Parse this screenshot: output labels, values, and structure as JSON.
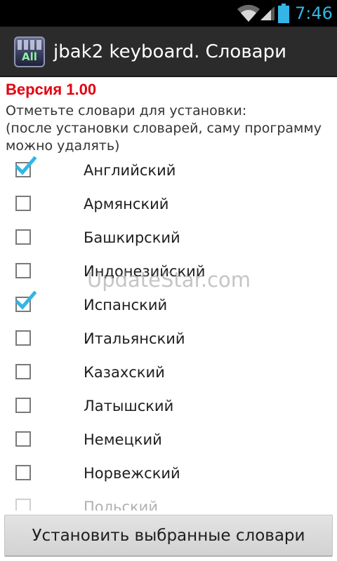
{
  "status_bar": {
    "time": "7:46",
    "icons": [
      "wifi-icon",
      "signal-icon",
      "battery-icon"
    ],
    "clock_color": "#33b5e5"
  },
  "action_bar": {
    "app_icon_text": "All",
    "title": "jbak2 keyboard. Словари"
  },
  "content": {
    "version": "Версия 1.00",
    "instructions_line1": "Отметьте словари для установки:",
    "instructions_line2": "(после установки словарей, саму программу",
    "instructions_line3": "можно удалять)",
    "dictionaries": [
      {
        "label": "Английский",
        "checked": true
      },
      {
        "label": "Армянский",
        "checked": false
      },
      {
        "label": "Башкирский",
        "checked": false
      },
      {
        "label": "Индонезийский",
        "checked": false
      },
      {
        "label": "Испанский",
        "checked": true
      },
      {
        "label": "Итальянский",
        "checked": false
      },
      {
        "label": "Казахский",
        "checked": false
      },
      {
        "label": "Латышский",
        "checked": false
      },
      {
        "label": "Немецкий",
        "checked": false
      },
      {
        "label": "Норвежский",
        "checked": false
      },
      {
        "label": "Польский",
        "checked": false
      }
    ]
  },
  "watermark": "UpdateStar.com",
  "install_button_label": "Установить выбранные словари",
  "colors": {
    "version_red": "#e3000f",
    "check_blue": "#33b5e5",
    "action_bar_bg": "#2b2b2b"
  }
}
